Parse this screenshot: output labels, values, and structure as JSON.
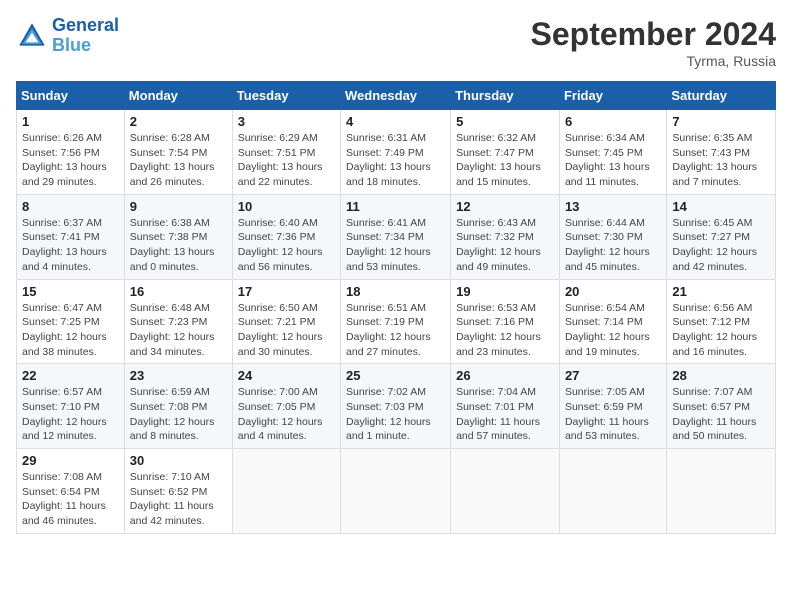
{
  "header": {
    "logo_line1": "General",
    "logo_line2": "Blue",
    "month": "September 2024",
    "location": "Tyrma, Russia"
  },
  "weekdays": [
    "Sunday",
    "Monday",
    "Tuesday",
    "Wednesday",
    "Thursday",
    "Friday",
    "Saturday"
  ],
  "weeks": [
    [
      {
        "day": "1",
        "info": "Sunrise: 6:26 AM\nSunset: 7:56 PM\nDaylight: 13 hours\nand 29 minutes."
      },
      {
        "day": "2",
        "info": "Sunrise: 6:28 AM\nSunset: 7:54 PM\nDaylight: 13 hours\nand 26 minutes."
      },
      {
        "day": "3",
        "info": "Sunrise: 6:29 AM\nSunset: 7:51 PM\nDaylight: 13 hours\nand 22 minutes."
      },
      {
        "day": "4",
        "info": "Sunrise: 6:31 AM\nSunset: 7:49 PM\nDaylight: 13 hours\nand 18 minutes."
      },
      {
        "day": "5",
        "info": "Sunrise: 6:32 AM\nSunset: 7:47 PM\nDaylight: 13 hours\nand 15 minutes."
      },
      {
        "day": "6",
        "info": "Sunrise: 6:34 AM\nSunset: 7:45 PM\nDaylight: 13 hours\nand 11 minutes."
      },
      {
        "day": "7",
        "info": "Sunrise: 6:35 AM\nSunset: 7:43 PM\nDaylight: 13 hours\nand 7 minutes."
      }
    ],
    [
      {
        "day": "8",
        "info": "Sunrise: 6:37 AM\nSunset: 7:41 PM\nDaylight: 13 hours\nand 4 minutes."
      },
      {
        "day": "9",
        "info": "Sunrise: 6:38 AM\nSunset: 7:38 PM\nDaylight: 13 hours\nand 0 minutes."
      },
      {
        "day": "10",
        "info": "Sunrise: 6:40 AM\nSunset: 7:36 PM\nDaylight: 12 hours\nand 56 minutes."
      },
      {
        "day": "11",
        "info": "Sunrise: 6:41 AM\nSunset: 7:34 PM\nDaylight: 12 hours\nand 53 minutes."
      },
      {
        "day": "12",
        "info": "Sunrise: 6:43 AM\nSunset: 7:32 PM\nDaylight: 12 hours\nand 49 minutes."
      },
      {
        "day": "13",
        "info": "Sunrise: 6:44 AM\nSunset: 7:30 PM\nDaylight: 12 hours\nand 45 minutes."
      },
      {
        "day": "14",
        "info": "Sunrise: 6:45 AM\nSunset: 7:27 PM\nDaylight: 12 hours\nand 42 minutes."
      }
    ],
    [
      {
        "day": "15",
        "info": "Sunrise: 6:47 AM\nSunset: 7:25 PM\nDaylight: 12 hours\nand 38 minutes."
      },
      {
        "day": "16",
        "info": "Sunrise: 6:48 AM\nSunset: 7:23 PM\nDaylight: 12 hours\nand 34 minutes."
      },
      {
        "day": "17",
        "info": "Sunrise: 6:50 AM\nSunset: 7:21 PM\nDaylight: 12 hours\nand 30 minutes."
      },
      {
        "day": "18",
        "info": "Sunrise: 6:51 AM\nSunset: 7:19 PM\nDaylight: 12 hours\nand 27 minutes."
      },
      {
        "day": "19",
        "info": "Sunrise: 6:53 AM\nSunset: 7:16 PM\nDaylight: 12 hours\nand 23 minutes."
      },
      {
        "day": "20",
        "info": "Sunrise: 6:54 AM\nSunset: 7:14 PM\nDaylight: 12 hours\nand 19 minutes."
      },
      {
        "day": "21",
        "info": "Sunrise: 6:56 AM\nSunset: 7:12 PM\nDaylight: 12 hours\nand 16 minutes."
      }
    ],
    [
      {
        "day": "22",
        "info": "Sunrise: 6:57 AM\nSunset: 7:10 PM\nDaylight: 12 hours\nand 12 minutes."
      },
      {
        "day": "23",
        "info": "Sunrise: 6:59 AM\nSunset: 7:08 PM\nDaylight: 12 hours\nand 8 minutes."
      },
      {
        "day": "24",
        "info": "Sunrise: 7:00 AM\nSunset: 7:05 PM\nDaylight: 12 hours\nand 4 minutes."
      },
      {
        "day": "25",
        "info": "Sunrise: 7:02 AM\nSunset: 7:03 PM\nDaylight: 12 hours\nand 1 minute."
      },
      {
        "day": "26",
        "info": "Sunrise: 7:04 AM\nSunset: 7:01 PM\nDaylight: 11 hours\nand 57 minutes."
      },
      {
        "day": "27",
        "info": "Sunrise: 7:05 AM\nSunset: 6:59 PM\nDaylight: 11 hours\nand 53 minutes."
      },
      {
        "day": "28",
        "info": "Sunrise: 7:07 AM\nSunset: 6:57 PM\nDaylight: 11 hours\nand 50 minutes."
      }
    ],
    [
      {
        "day": "29",
        "info": "Sunrise: 7:08 AM\nSunset: 6:54 PM\nDaylight: 11 hours\nand 46 minutes."
      },
      {
        "day": "30",
        "info": "Sunrise: 7:10 AM\nSunset: 6:52 PM\nDaylight: 11 hours\nand 42 minutes."
      },
      {
        "day": "",
        "info": ""
      },
      {
        "day": "",
        "info": ""
      },
      {
        "day": "",
        "info": ""
      },
      {
        "day": "",
        "info": ""
      },
      {
        "day": "",
        "info": ""
      }
    ]
  ]
}
